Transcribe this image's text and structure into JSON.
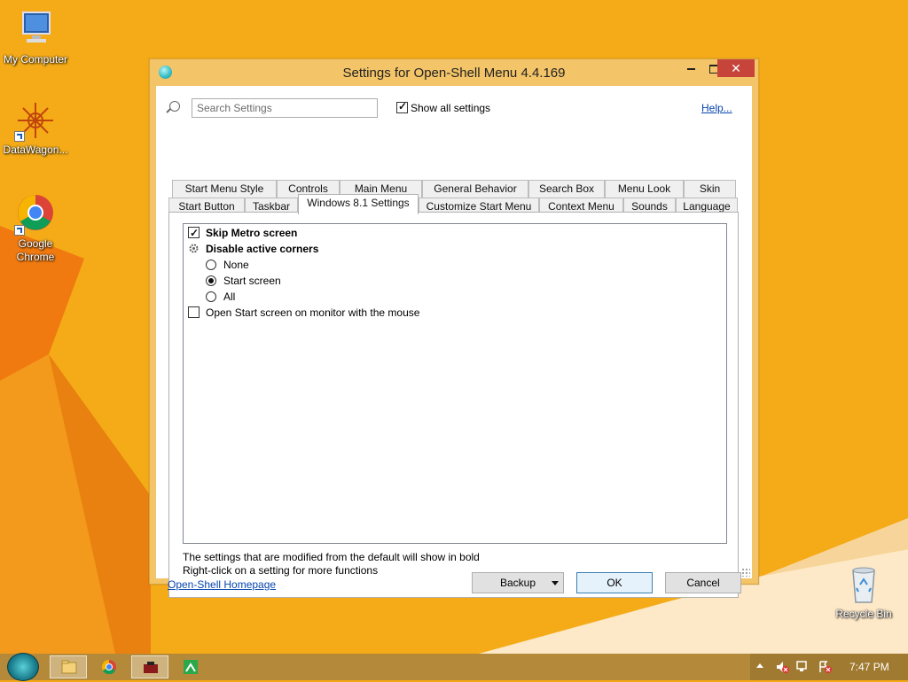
{
  "desktop": {
    "icons": [
      {
        "label": "My Computer"
      },
      {
        "label": "DataWagon..."
      },
      {
        "label": "Google Chrome"
      },
      {
        "label": "Recycle Bin"
      }
    ]
  },
  "window": {
    "title": "Settings for Open-Shell Menu 4.4.169",
    "search": {
      "placeholder": "Search Settings",
      "value": ""
    },
    "show_all": {
      "label": "Show all settings",
      "checked": true
    },
    "help_label": "Help...",
    "tabs_row1": [
      "Start Menu Style",
      "Controls",
      "Main Menu",
      "General Behavior",
      "Search Box",
      "Menu Look",
      "Skin"
    ],
    "tabs_row2": [
      "Start Button",
      "Taskbar",
      "Windows 8.1 Settings",
      "Customize Start Menu",
      "Context Menu",
      "Sounds",
      "Language"
    ],
    "active_tab": "Windows 8.1 Settings",
    "settings": {
      "skip_metro": {
        "label": "Skip Metro screen",
        "checked": true
      },
      "disable_corners": {
        "label": "Disable active corners"
      },
      "options": [
        {
          "label": "None",
          "selected": false
        },
        {
          "label": "Start screen",
          "selected": true
        },
        {
          "label": "All",
          "selected": false
        }
      ],
      "open_start": {
        "label": "Open Start screen on monitor with the mouse",
        "checked": false
      }
    },
    "notes": [
      "The settings that are modified from the default will show in bold",
      "Right-click on a setting for more functions"
    ],
    "homepage_label": "Open-Shell Homepage",
    "buttons": {
      "backup": "Backup",
      "ok": "OK",
      "cancel": "Cancel"
    }
  },
  "taskbar": {
    "clock": "7:47 PM"
  },
  "colors": {
    "desktop": "#f3a814",
    "window_frame": "#f3c468",
    "close_button": "#c7443a",
    "taskbar": "#b48a3a"
  }
}
